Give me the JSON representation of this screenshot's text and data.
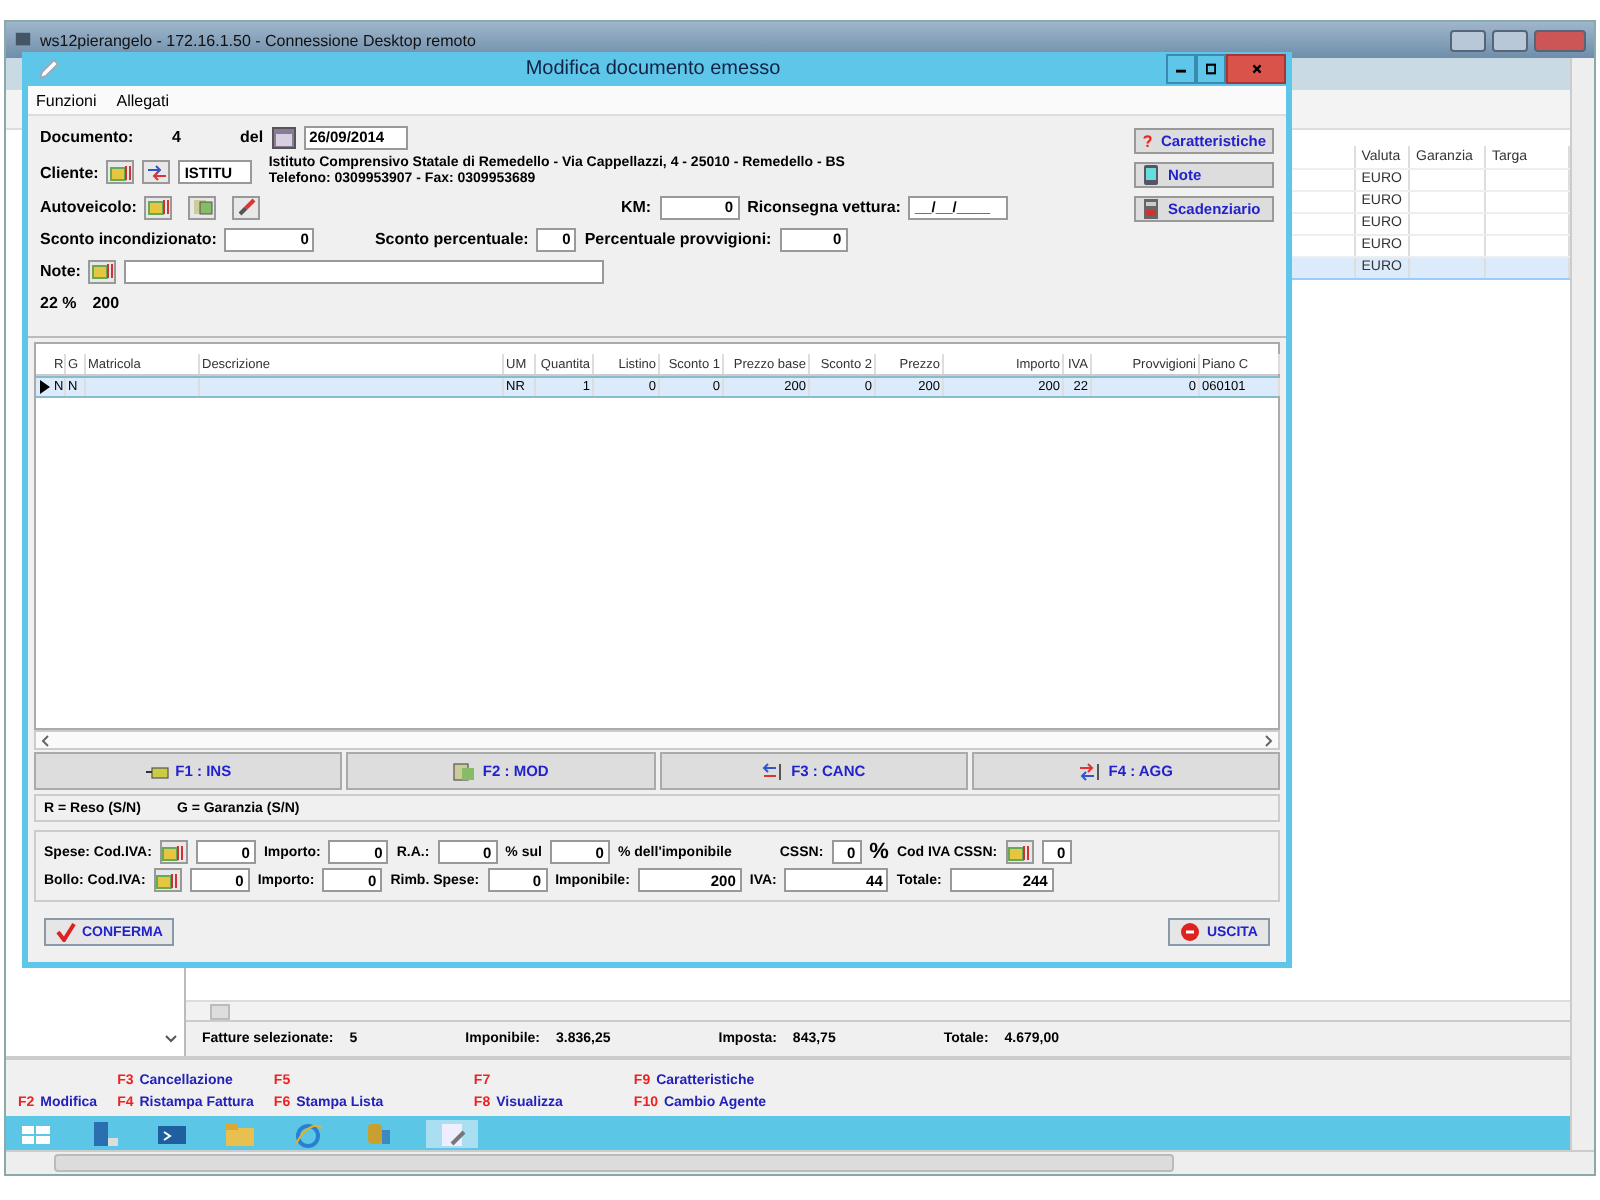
{
  "remote_window": {
    "title": "ws12pierangelo - 172.16.1.50 - Connessione Desktop remoto"
  },
  "background_app": {
    "table": {
      "columns": [
        "Valuta",
        "Garanzia",
        "Targa"
      ],
      "rows": [
        {
          "cells": [
            "EURO"
          ],
          "selected": false
        },
        {
          "cells": [
            "EURO"
          ],
          "selected": false
        },
        {
          "cells": [
            "EURO"
          ],
          "selected": false
        },
        {
          "cells": [
            "EURO"
          ],
          "selected": false
        },
        {
          "cells": [
            "EURO"
          ],
          "selected": true
        }
      ]
    },
    "summary": [
      {
        "label": "Fatture selezionate:",
        "value": "5"
      },
      {
        "label": "Imponibile:",
        "value": "3.836,25"
      },
      {
        "label": "Imposta:",
        "value": "843,75"
      },
      {
        "label": "Totale:",
        "value": "4.679,00"
      }
    ],
    "function_key_columns": [
      [
        {
          "key": "F2",
          "label": "Modifica"
        }
      ],
      [
        {
          "key": "F3",
          "label": "Cancellazione"
        },
        {
          "key": "F4",
          "label": "Ristampa Fattura"
        }
      ],
      [
        {
          "key": "F5"
        },
        {
          "key": "F6",
          "label": "Stampa Lista"
        }
      ],
      [
        {
          "key": "F7"
        },
        {
          "key": "F8",
          "label": "Visualizza"
        }
      ],
      [
        {
          "key": "F9",
          "label": "Caratteristiche"
        },
        {
          "key": "F10",
          "label": "Cambio Agente"
        }
      ]
    ]
  },
  "dialog": {
    "title": "Modifica documento emesso",
    "menu": [
      "Funzioni",
      "Allegati"
    ],
    "documento": {
      "label": "Documento:",
      "number": "4",
      "date_label": "del",
      "date": "26/09/2014"
    },
    "cliente": {
      "label": "Cliente:",
      "code": "ISTITU",
      "name": "Istituto Comprensivo Statale di Remedello - Via Cappellazzi, 4 - 25010 - Remedello - BS",
      "contacts": "Telefono: 0309953907 - Fax: 0309953689"
    },
    "autoveicolo": {
      "label": "Autoveicolo:"
    },
    "km": {
      "label": "KM:",
      "value": "0"
    },
    "riconsegna": {
      "label": "Riconsegna vettura:",
      "value": "__/__/____"
    },
    "sconto_incondizionato": {
      "label": "Sconto incondizionato:",
      "value": "0"
    },
    "sconto_percentuale": {
      "label": "Sconto percentuale:",
      "value": "0"
    },
    "percentuale_provvigioni": {
      "label": "Percentuale provvigioni:",
      "value": "0"
    },
    "note": {
      "label": "Note:"
    },
    "vat_summary": [
      "22 %",
      "200"
    ],
    "side_buttons": [
      {
        "label": "Caratteristiche",
        "kind": "help"
      },
      {
        "label": "Note",
        "kind": "phone"
      },
      {
        "label": "Scadenziario",
        "kind": "calculator"
      }
    ],
    "grid": {
      "columns": [
        "R",
        "G",
        "Matricola",
        "Descrizione",
        "UM",
        "Quantita",
        "Listino",
        "Sconto 1",
        "Prezzo base",
        "Sconto 2",
        "Prezzo",
        "Importo",
        "IVA",
        "Provvigioni",
        "Piano C"
      ],
      "rows": [
        {
          "cells": [
            "N",
            "N",
            null,
            null,
            "NR",
            "1",
            "0",
            "0",
            "200",
            "0",
            "200",
            "200",
            "22",
            "0",
            "060101"
          ],
          "selected": true
        }
      ]
    },
    "action_buttons": [
      {
        "label": "F1 : INS",
        "kind": "insert"
      },
      {
        "label": "F2 : MOD",
        "kind": "edit"
      },
      {
        "label": "F3 : CANC",
        "kind": "delete"
      },
      {
        "label": "F4 : AGG",
        "kind": "update"
      }
    ],
    "legend": [
      "R = Reso (S/N)",
      "G = Garanzia (S/N)"
    ],
    "totals": [
      [
        {
          "kind": "label",
          "text": "Spese: Cod.IVA:"
        },
        {
          "kind": "lookup"
        },
        {
          "kind": "field",
          "value": "0"
        },
        {
          "kind": "label",
          "text": "Importo:"
        },
        {
          "kind": "field",
          "value": "0"
        },
        {
          "kind": "label",
          "text": "R.A.:"
        },
        {
          "kind": "field",
          "value": "0"
        },
        {
          "kind": "label",
          "text": "% sul"
        },
        {
          "kind": "field",
          "value": "0"
        },
        {
          "kind": "label",
          "text": "% dell'imponibile"
        },
        {
          "kind": "spacer"
        },
        {
          "kind": "label",
          "text": "CSSN:"
        },
        {
          "kind": "tiny_field",
          "value": "0"
        },
        {
          "kind": "big_label",
          "text": "%"
        },
        {
          "kind": "label",
          "text": "Cod IVA CSSN:"
        },
        {
          "kind": "lookup"
        },
        {
          "kind": "tiny_field",
          "value": "0"
        }
      ],
      [
        {
          "kind": "label",
          "text": "Bollo: Cod.IVA:"
        },
        {
          "kind": "lookup"
        },
        {
          "kind": "field",
          "value": "0"
        },
        {
          "kind": "label",
          "text": "Importo:"
        },
        {
          "kind": "field",
          "value": "0"
        },
        {
          "kind": "label",
          "text": "Rimb. Spese:"
        },
        {
          "kind": "field",
          "value": "0"
        },
        {
          "kind": "label",
          "text": "Imponibile:"
        },
        {
          "kind": "wide_field",
          "value": "200"
        },
        {
          "kind": "label",
          "text": "IVA:"
        },
        {
          "kind": "wide_field",
          "value": "44"
        },
        {
          "kind": "label",
          "text": "Totale:"
        },
        {
          "kind": "wide_field",
          "value": "244"
        }
      ]
    ],
    "footer_buttons": [
      {
        "label": "CONFERMA",
        "kind": "confirm"
      },
      {
        "label": "USCITA",
        "kind": "exit"
      }
    ]
  }
}
